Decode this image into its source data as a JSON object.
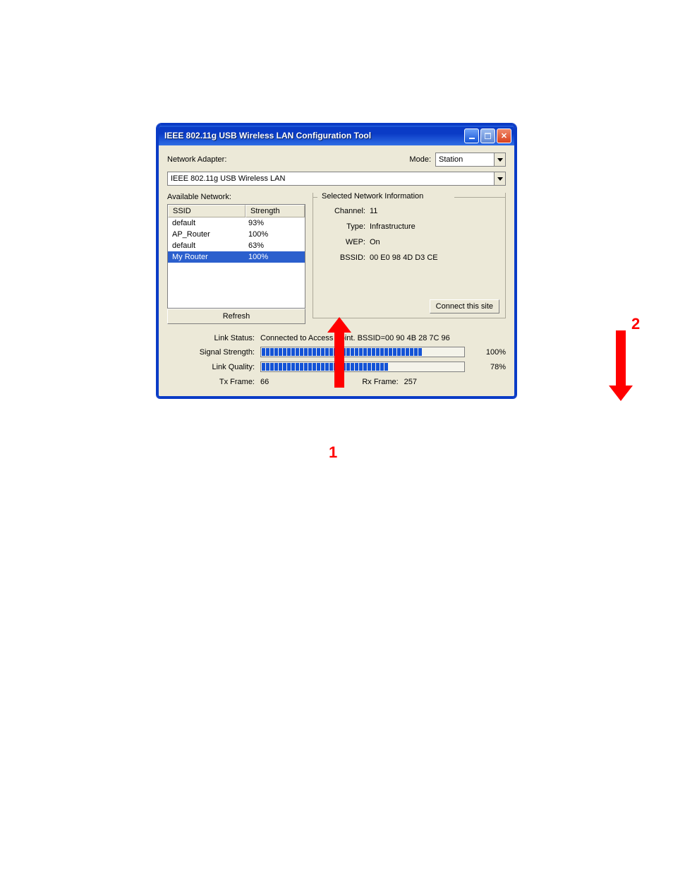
{
  "window": {
    "title": "IEEE 802.11g USB Wireless LAN Configuration Tool"
  },
  "toolbar": {
    "network_adapter_label": "Network Adapter:",
    "mode_label": "Mode:",
    "mode_value": "Station",
    "adapter_value": "IEEE 802.11g USB Wireless LAN"
  },
  "available": {
    "label": "Available Network:",
    "col_ssid": "SSID",
    "col_strength": "Strength",
    "rows": [
      {
        "ssid": "default",
        "strength": "93%",
        "selected": false
      },
      {
        "ssid": "AP_Router",
        "strength": "100%",
        "selected": false
      },
      {
        "ssid": "default",
        "strength": "63%",
        "selected": false
      },
      {
        "ssid": "My Router",
        "strength": "100%",
        "selected": true
      }
    ],
    "refresh_label": "Refresh"
  },
  "info": {
    "group_title": "Selected Network Information",
    "channel_label": "Channel:",
    "channel_value": "11",
    "type_label": "Type:",
    "type_value": "Infrastructure",
    "wep_label": "WEP:",
    "wep_value": "On",
    "bssid_label": "BSSID:",
    "bssid_value": "00 E0 98 4D D3 CE",
    "connect_label": "Connect this site"
  },
  "status": {
    "link_status_label": "Link Status:",
    "link_status_value": "Connected to Access Point. BSSID=00 90 4B 28 7C 96",
    "signal_label": "Signal Strength:",
    "signal_pct": "100%",
    "signal_val": 100,
    "quality_label": "Link Quality:",
    "quality_pct": "78%",
    "quality_val": 78,
    "tx_label": "Tx Frame:",
    "tx_value": "66",
    "rx_label": "Rx Frame:",
    "rx_value": "257"
  },
  "annotations": {
    "one": "1",
    "two": "2"
  }
}
